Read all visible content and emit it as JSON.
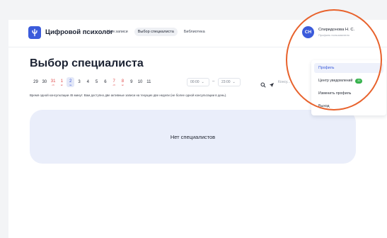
{
  "brand": {
    "name": "Цифровой психолог"
  },
  "nav": [
    {
      "label": "Мои записи"
    },
    {
      "label": "Выбор специалиста"
    },
    {
      "label": "Библиотека"
    }
  ],
  "user": {
    "initials": "СН",
    "name": "Спиридонова Н. С.",
    "role": "Профиль пользователя"
  },
  "page": {
    "title": "Выбор специалиста"
  },
  "dates": [
    {
      "day": "29",
      "red": false,
      "weekday": ""
    },
    {
      "day": "30",
      "red": false,
      "weekday": ""
    },
    {
      "day": "31",
      "red": true,
      "weekday": "сб"
    },
    {
      "day": "1",
      "red": true,
      "weekday": "вс"
    },
    {
      "day": "2",
      "red": false,
      "weekday": "пн",
      "selected": true
    },
    {
      "day": "3",
      "red": false,
      "weekday": ""
    },
    {
      "day": "4",
      "red": false,
      "weekday": ""
    },
    {
      "day": "5",
      "red": false,
      "weekday": ""
    },
    {
      "day": "6",
      "red": false,
      "weekday": ""
    },
    {
      "day": "7",
      "red": true,
      "weekday": "сб"
    },
    {
      "day": "8",
      "red": true,
      "weekday": "вс"
    },
    {
      "day": "9",
      "red": false,
      "weekday": ""
    },
    {
      "day": "10",
      "red": false,
      "weekday": ""
    },
    {
      "day": "11",
      "red": false,
      "weekday": ""
    }
  ],
  "time": {
    "from": "00:00",
    "to": "23:00",
    "dash": "–"
  },
  "consult_label": "Консу...",
  "note": "Время одной консультации 45 минут. Вам доступно две активные записи на текущие две недели (не более одной консультации в день).",
  "empty_state": "Нет специалистов",
  "menu": {
    "items": [
      {
        "label": "Профиль"
      },
      {
        "label": "Центр уведомлений",
        "badge": "20"
      },
      {
        "label": "Изменить профиль"
      },
      {
        "label": "Выход"
      }
    ]
  },
  "colors": {
    "accent": "#3b5bdb",
    "highlight": "#e8622c",
    "badge": "#37b24d"
  },
  "icons": [
    "logo-icon",
    "search-icon",
    "send-icon",
    "chevron-down-icon"
  ]
}
